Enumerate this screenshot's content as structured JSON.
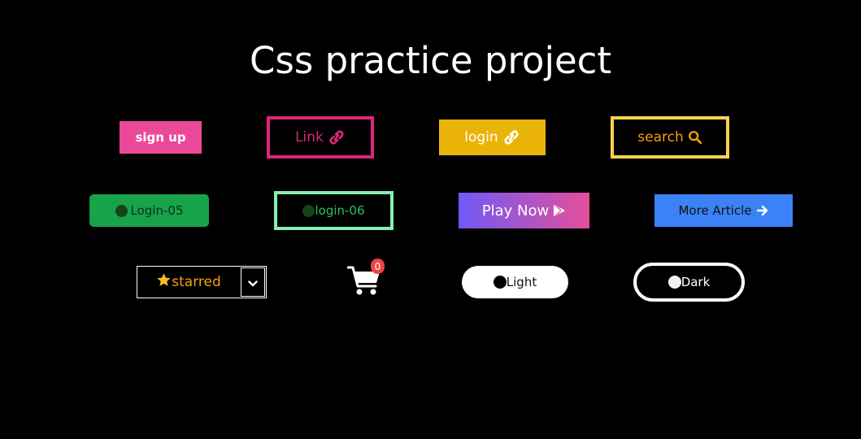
{
  "page": {
    "title": "Css practice project"
  },
  "row1": {
    "signup": "sign up",
    "link": "Link",
    "login": "login",
    "search": "search"
  },
  "row2": {
    "login05": "Login-05",
    "login06": "login-06",
    "playnow": "Play Now",
    "more": "More Article"
  },
  "row3": {
    "starred": "starred",
    "cart_count": "0",
    "light": "Light",
    "dark": "Dark"
  },
  "icons": {
    "link": "link-icon",
    "login": "link-icon",
    "search": "search-icon",
    "play": "play-store-icon",
    "more": "arrow-right-icon",
    "star": "star-icon",
    "dropdown": "chevron-down-icon",
    "cart": "cart-icon"
  },
  "colors": {
    "background": "#000000",
    "signup": "#ec4899",
    "link_border": "#db2777",
    "login": "#eab308",
    "search_border": "#fcd34d",
    "search_text": "#f59e0b",
    "login05": "#16a34a",
    "login06_border": "#86efac",
    "more": "#3b82f6",
    "badge": "#ef4444"
  }
}
